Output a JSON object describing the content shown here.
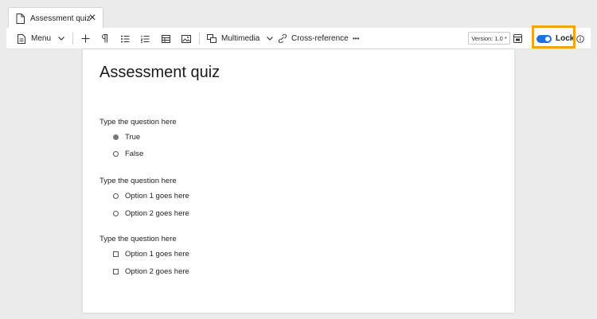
{
  "tab": {
    "title": "Assessment quiz",
    "close": "✕"
  },
  "toolbar": {
    "menu_label": "Menu",
    "multimedia_label": "Multimedia",
    "cross_reference_label": "Cross-reference",
    "more_label": "•••",
    "version_label": "Version: 1.0 *",
    "lock_label": "Lock",
    "lock_on": true,
    "icons": [
      "document-icon",
      "chevron-down-icon",
      "plus-icon",
      "pilcrow-icon",
      "bulleted-list-icon",
      "numbered-list-icon",
      "table-icon",
      "image-icon",
      "multimedia-icon",
      "cross-reference-icon",
      "more-icon",
      "version-history-icon",
      "info-icon"
    ]
  },
  "colors": {
    "accent": "#1e6fe0",
    "highlight": "#f0a417"
  },
  "document": {
    "title": "Assessment quiz",
    "questions": [
      {
        "text": "Type the question here",
        "type": "radio",
        "options": [
          {
            "label": "True",
            "selected": true
          },
          {
            "label": "False",
            "selected": false
          }
        ]
      },
      {
        "text": "Type the question here",
        "type": "radio",
        "options": [
          {
            "label": "Option 1 goes here",
            "selected": false
          },
          {
            "label": "Option 2 goes here",
            "selected": false
          }
        ]
      },
      {
        "text": "Type the question here",
        "type": "checkbox",
        "options": [
          {
            "label": "Option 1 goes here",
            "selected": false
          },
          {
            "label": "Option 2 goes here",
            "selected": false
          }
        ]
      }
    ]
  }
}
